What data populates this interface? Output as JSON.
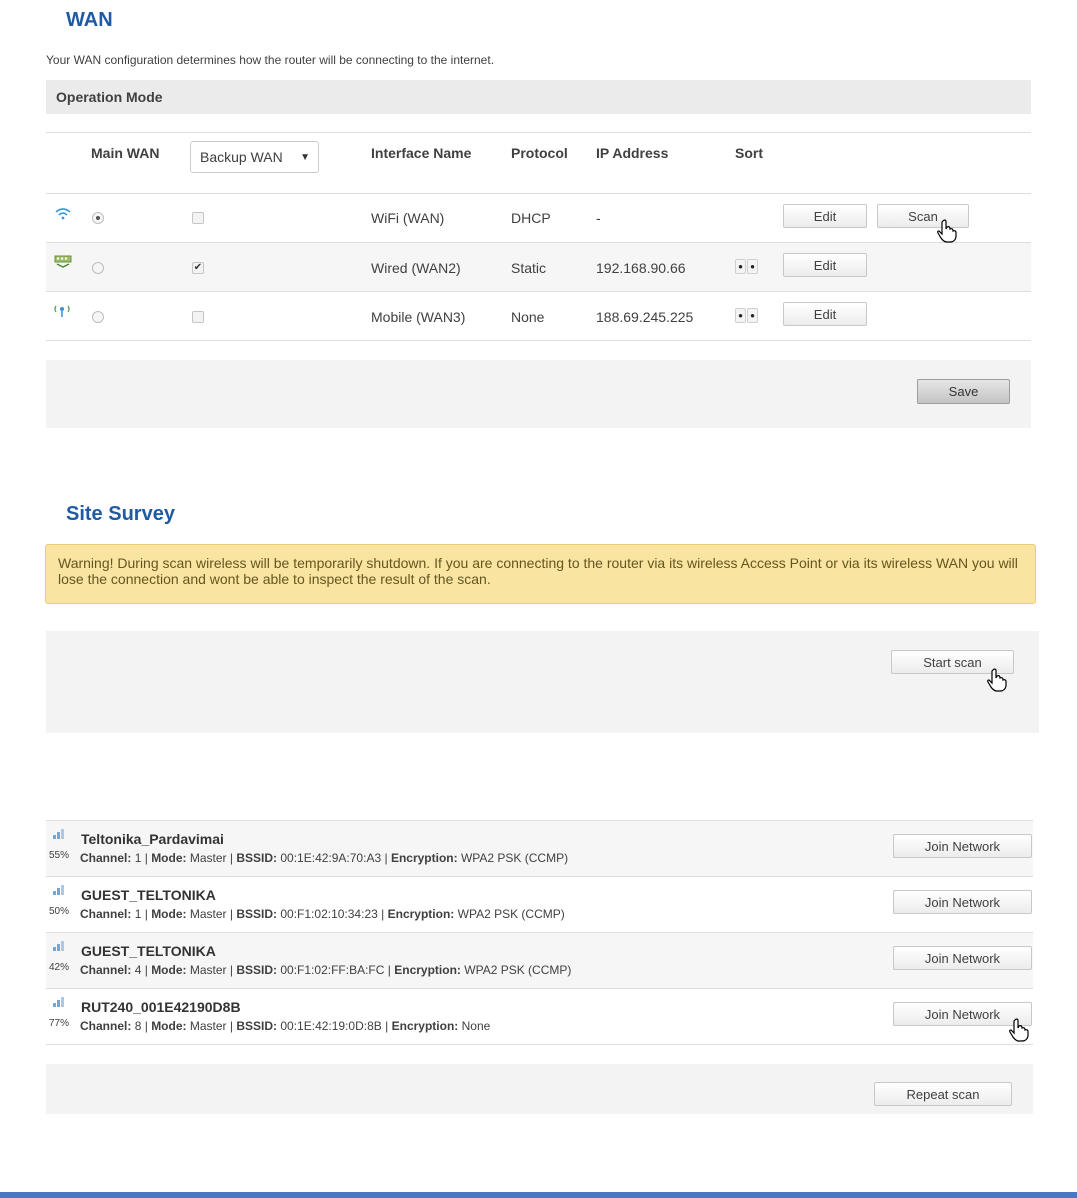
{
  "wan": {
    "title": "WAN",
    "description": "Your WAN configuration determines how the router will be connecting to the internet.",
    "operation_mode_label": "Operation Mode",
    "columns": {
      "main_wan": "Main WAN",
      "backup_wan_select": "Backup WAN",
      "interface_name": "Interface Name",
      "protocol": "Protocol",
      "ip_address": "IP Address",
      "sort": "Sort"
    },
    "rows": [
      {
        "interface": "WiFi (WAN)",
        "protocol": "DHCP",
        "ip": "-",
        "main": true,
        "backup": false,
        "edit_label": "Edit",
        "scan_label": "Scan"
      },
      {
        "interface": "Wired (WAN2)",
        "protocol": "Static",
        "ip": "192.168.90.66",
        "main": false,
        "backup": true,
        "edit_label": "Edit"
      },
      {
        "interface": "Mobile (WAN3)",
        "protocol": "None",
        "ip": "188.69.245.225",
        "main": false,
        "backup": false,
        "edit_label": "Edit"
      }
    ],
    "save_label": "Save"
  },
  "site_survey": {
    "title": "Site Survey",
    "warning": "Warning! During scan wireless will be temporarily shutdown. If you are connecting to the router via its wireless Access Point or via its wireless WAN you will lose the connection and wont be able to inspect the result of the scan.",
    "start_scan_label": "Start scan",
    "repeat_scan_label": "Repeat scan",
    "labels": {
      "channel": "Channel:",
      "mode": "Mode:",
      "bssid": "BSSID:",
      "encryption": "Encryption:",
      "separator": "|"
    },
    "networks": [
      {
        "ssid": "Teltonika_Pardavimai",
        "signal": "55%",
        "channel": "1",
        "mode": "Master",
        "bssid": "00:1E:42:9A:70:A3",
        "encryption": "WPA2 PSK (CCMP)",
        "join_label": "Join Network"
      },
      {
        "ssid": "GUEST_TELTONIKA",
        "signal": "50%",
        "channel": "1",
        "mode": "Master",
        "bssid": "00:F1:02:10:34:23",
        "encryption": "WPA2 PSK (CCMP)",
        "join_label": "Join Network"
      },
      {
        "ssid": "GUEST_TELTONIKA",
        "signal": "42%",
        "channel": "4",
        "mode": "Master",
        "bssid": "00:F1:02:FF:BA:FC",
        "encryption": "WPA2 PSK (CCMP)",
        "join_label": "Join Network"
      },
      {
        "ssid": "RUT240_001E42190D8B",
        "signal": "77%",
        "channel": "8",
        "mode": "Master",
        "bssid": "00:1E:42:19:0D:8B",
        "encryption": "None",
        "join_label": "Join Network"
      }
    ]
  },
  "colors": {
    "title_blue": "#1f5aa3",
    "warning_bg": "#f9e5a1",
    "footer_blue": "#4a77c1"
  }
}
